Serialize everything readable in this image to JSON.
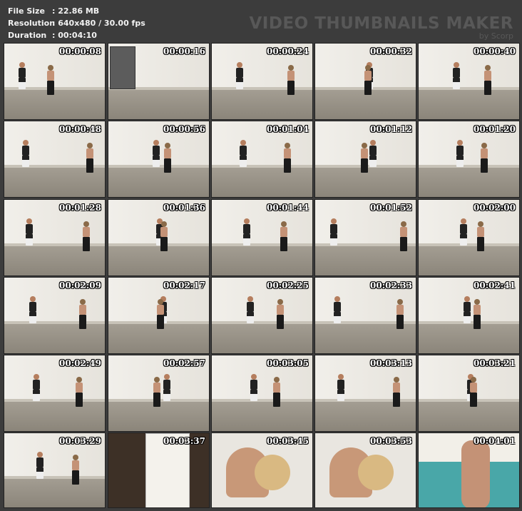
{
  "info": {
    "file_size_label": "File Size",
    "file_size_value": ": 22.86 MB",
    "resolution_label": "Resolution",
    "resolution_value": ": 640x480 / 30.00 fps",
    "duration_label": "Duration",
    "duration_value": ": 00:04:10"
  },
  "watermark": {
    "title": "VIDEO THUMBNAILS MAKER",
    "subtitle": "by Scorp"
  },
  "thumbnails": [
    "00:00:08",
    "00:00:16",
    "00:00:24",
    "00:00:32",
    "00:00:40",
    "00:00:48",
    "00:00:56",
    "00:01:04",
    "00:01:12",
    "00:01:20",
    "00:01:28",
    "00:01:36",
    "00:01:44",
    "00:01:52",
    "00:02:00",
    "00:02:09",
    "00:02:17",
    "00:02:25",
    "00:02:33",
    "00:02:41",
    "00:02:49",
    "00:02:57",
    "00:03:05",
    "00:03:13",
    "00:03:21",
    "00:03:29",
    "00:03:37",
    "00:03:45",
    "00:03:53",
    "00:04:01"
  ]
}
